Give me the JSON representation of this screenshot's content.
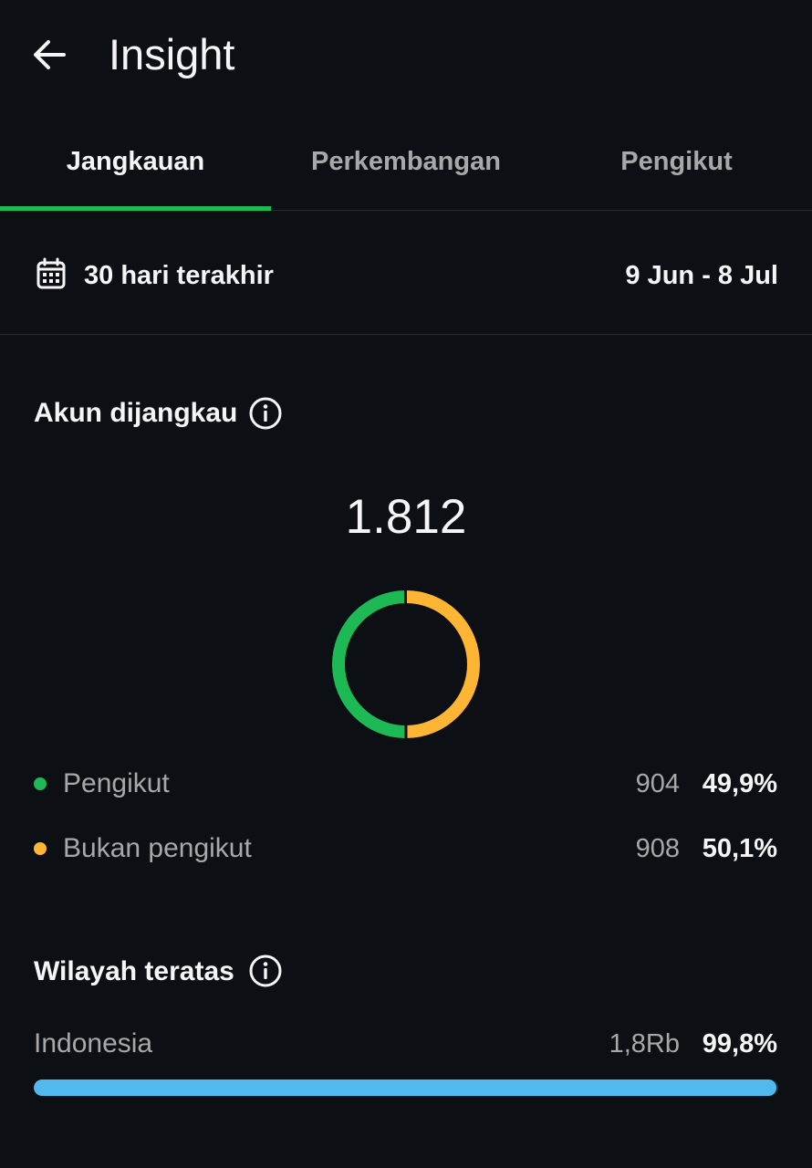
{
  "header": {
    "title": "Insight",
    "back_icon": "arrow-left-icon"
  },
  "tabs": [
    {
      "label": "Jangkauan",
      "active": true
    },
    {
      "label": "Perkembangan",
      "active": false
    },
    {
      "label": "Pengikut",
      "active": false
    }
  ],
  "range": {
    "icon": "calendar-icon",
    "label": "30 hari terakhir",
    "dates": "9 Jun - 8 Jul"
  },
  "reach": {
    "title": "Akun dijangkau",
    "info_icon": "info-icon",
    "total": "1.812",
    "legend": [
      {
        "label": "Pengikut",
        "count": "904",
        "percent": "49,9%",
        "color": "#1db954"
      },
      {
        "label": "Bukan pengikut",
        "count": "908",
        "percent": "50,1%",
        "color": "#ffb534"
      }
    ]
  },
  "chart_data": {
    "type": "pie",
    "categories": [
      "Pengikut",
      "Bukan pengikut"
    ],
    "values": [
      904,
      908
    ],
    "colors": [
      "#1db954",
      "#ffb534"
    ]
  },
  "regions": {
    "title": "Wilayah teratas",
    "info_icon": "info-icon",
    "items": [
      {
        "label": "Indonesia",
        "count": "1,8Rb",
        "percent": "99,8%",
        "fraction": 0.998,
        "color": "#52b9ef"
      }
    ]
  },
  "colors": {
    "background": "#0c1014",
    "accent": "#1db954",
    "text_primary": "#f5f5f5",
    "text_secondary": "#a8a8a8"
  }
}
